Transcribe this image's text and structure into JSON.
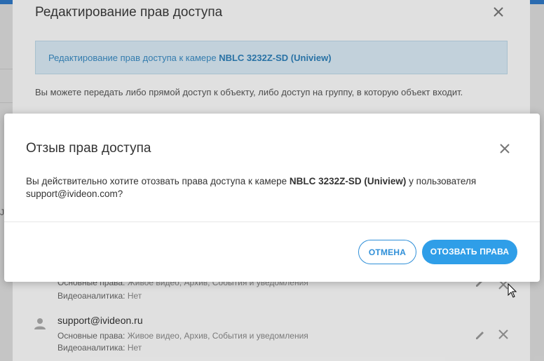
{
  "edit_dialog": {
    "title": "Редактирование прав доступа",
    "banner_prefix": "Редактирование прав доступа к камере ",
    "banner_camera": "NBLC 3232Z-SD (Uniview)",
    "description": "Вы можете передать либо прямой доступ к объекту, либо доступ на группу, в которую объект входит.",
    "users": [
      {
        "name": "",
        "basic_rights_label": "Основные права:",
        "basic_rights_value": "Живое видео, Архив, События и уведомления",
        "analytics_label": "Видеоаналитика:",
        "analytics_value": "Нет"
      },
      {
        "name": "support@ivideon.ru",
        "basic_rights_label": "Основные права:",
        "basic_rights_value": "Живое видео, Архив, События и уведомления",
        "analytics_label": "Видеоаналитика:",
        "analytics_value": "Нет"
      }
    ]
  },
  "confirm_modal": {
    "title": "Отзыв прав доступа",
    "body_prefix": "Вы действительно хотите отозвать права доступа к камере ",
    "body_camera": "NBLC 3232Z-SD (Uniview)",
    "body_middle": " у пользователя ",
    "body_user": "support@ivideon.com",
    "body_suffix": "?",
    "cancel_label": "ОТМЕНА",
    "confirm_label": "ОТОЗВАТЬ ПРАВА"
  },
  "page": {
    "left_partial_char": "J"
  },
  "colors": {
    "accent": "#2f9ee8",
    "banner_bg": "#d8e9f4",
    "banner_text": "#3a8bc2",
    "top_bar": "#2f78c4"
  },
  "icons": [
    "close-icon",
    "user-icon",
    "pencil-icon",
    "delete-icon",
    "mouse-cursor-icon"
  ]
}
